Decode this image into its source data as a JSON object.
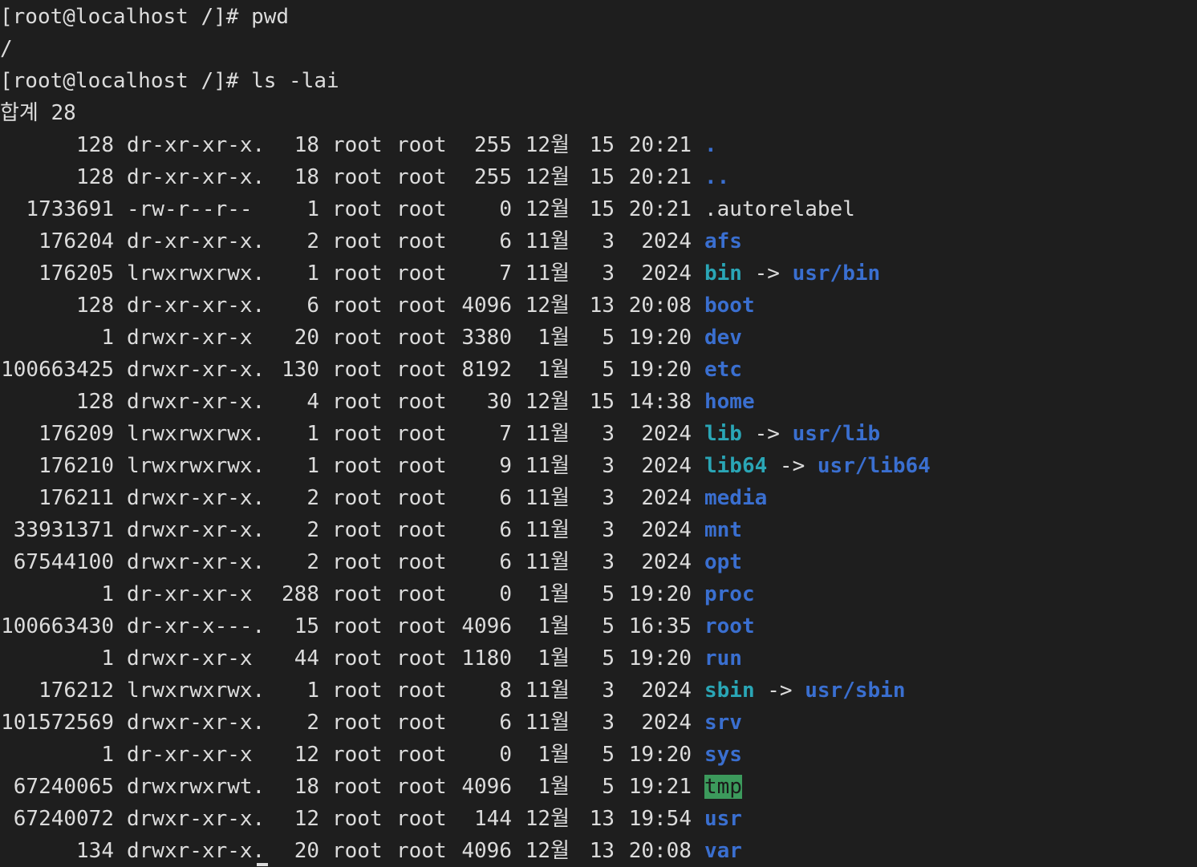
{
  "terminal": {
    "lines": [
      "[root@localhost /]# pwd",
      "/",
      "[root@localhost /]# ls -lai",
      "합계 28"
    ],
    "entries": [
      {
        "inode": "128",
        "perms": "dr-xr-xr-x.",
        "links": "18",
        "owner": "root",
        "group": "root",
        "size": "255",
        "month": "12월",
        "day": "15",
        "time": "20:21",
        "name": ".",
        "type": "dir",
        "target": ""
      },
      {
        "inode": "128",
        "perms": "dr-xr-xr-x.",
        "links": "18",
        "owner": "root",
        "group": "root",
        "size": "255",
        "month": "12월",
        "day": "15",
        "time": "20:21",
        "name": "..",
        "type": "dir",
        "target": ""
      },
      {
        "inode": "1733691",
        "perms": "-rw-r--r--",
        "links": "1",
        "owner": "root",
        "group": "root",
        "size": "0",
        "month": "12월",
        "day": "15",
        "time": "20:21",
        "name": ".autorelabel",
        "type": "file",
        "target": ""
      },
      {
        "inode": "176204",
        "perms": "dr-xr-xr-x.",
        "links": "2",
        "owner": "root",
        "group": "root",
        "size": "6",
        "month": "11월",
        "day": "3",
        "time": "2024",
        "name": "afs",
        "type": "dir",
        "target": ""
      },
      {
        "inode": "176205",
        "perms": "lrwxrwxrwx.",
        "links": "1",
        "owner": "root",
        "group": "root",
        "size": "7",
        "month": "11월",
        "day": "3",
        "time": "2024",
        "name": "bin",
        "type": "link",
        "target": "usr/bin"
      },
      {
        "inode": "128",
        "perms": "dr-xr-xr-x.",
        "links": "6",
        "owner": "root",
        "group": "root",
        "size": "4096",
        "month": "12월",
        "day": "13",
        "time": "20:08",
        "name": "boot",
        "type": "dir",
        "target": ""
      },
      {
        "inode": "1",
        "perms": "drwxr-xr-x",
        "links": "20",
        "owner": "root",
        "group": "root",
        "size": "3380",
        "month": "1월",
        "day": "5",
        "time": "19:20",
        "name": "dev",
        "type": "dir",
        "target": ""
      },
      {
        "inode": "100663425",
        "perms": "drwxr-xr-x.",
        "links": "130",
        "owner": "root",
        "group": "root",
        "size": "8192",
        "month": "1월",
        "day": "5",
        "time": "19:20",
        "name": "etc",
        "type": "dir",
        "target": ""
      },
      {
        "inode": "128",
        "perms": "drwxr-xr-x.",
        "links": "4",
        "owner": "root",
        "group": "root",
        "size": "30",
        "month": "12월",
        "day": "15",
        "time": "14:38",
        "name": "home",
        "type": "dir",
        "target": ""
      },
      {
        "inode": "176209",
        "perms": "lrwxrwxrwx.",
        "links": "1",
        "owner": "root",
        "group": "root",
        "size": "7",
        "month": "11월",
        "day": "3",
        "time": "2024",
        "name": "lib",
        "type": "link",
        "target": "usr/lib"
      },
      {
        "inode": "176210",
        "perms": "lrwxrwxrwx.",
        "links": "1",
        "owner": "root",
        "group": "root",
        "size": "9",
        "month": "11월",
        "day": "3",
        "time": "2024",
        "name": "lib64",
        "type": "link",
        "target": "usr/lib64"
      },
      {
        "inode": "176211",
        "perms": "drwxr-xr-x.",
        "links": "2",
        "owner": "root",
        "group": "root",
        "size": "6",
        "month": "11월",
        "day": "3",
        "time": "2024",
        "name": "media",
        "type": "dir",
        "target": ""
      },
      {
        "inode": "33931371",
        "perms": "drwxr-xr-x.",
        "links": "2",
        "owner": "root",
        "group": "root",
        "size": "6",
        "month": "11월",
        "day": "3",
        "time": "2024",
        "name": "mnt",
        "type": "dir",
        "target": ""
      },
      {
        "inode": "67544100",
        "perms": "drwxr-xr-x.",
        "links": "2",
        "owner": "root",
        "group": "root",
        "size": "6",
        "month": "11월",
        "day": "3",
        "time": "2024",
        "name": "opt",
        "type": "dir",
        "target": ""
      },
      {
        "inode": "1",
        "perms": "dr-xr-xr-x",
        "links": "288",
        "owner": "root",
        "group": "root",
        "size": "0",
        "month": "1월",
        "day": "5",
        "time": "19:20",
        "name": "proc",
        "type": "dir",
        "target": ""
      },
      {
        "inode": "100663430",
        "perms": "dr-xr-x---.",
        "links": "15",
        "owner": "root",
        "group": "root",
        "size": "4096",
        "month": "1월",
        "day": "5",
        "time": "16:35",
        "name": "root",
        "type": "dir",
        "target": ""
      },
      {
        "inode": "1",
        "perms": "drwxr-xr-x",
        "links": "44",
        "owner": "root",
        "group": "root",
        "size": "1180",
        "month": "1월",
        "day": "5",
        "time": "19:20",
        "name": "run",
        "type": "dir",
        "target": ""
      },
      {
        "inode": "176212",
        "perms": "lrwxrwxrwx.",
        "links": "1",
        "owner": "root",
        "group": "root",
        "size": "8",
        "month": "11월",
        "day": "3",
        "time": "2024",
        "name": "sbin",
        "type": "link",
        "target": "usr/sbin"
      },
      {
        "inode": "101572569",
        "perms": "drwxr-xr-x.",
        "links": "2",
        "owner": "root",
        "group": "root",
        "size": "6",
        "month": "11월",
        "day": "3",
        "time": "2024",
        "name": "srv",
        "type": "dir",
        "target": ""
      },
      {
        "inode": "1",
        "perms": "dr-xr-xr-x",
        "links": "12",
        "owner": "root",
        "group": "root",
        "size": "0",
        "month": "1월",
        "day": "5",
        "time": "19:20",
        "name": "sys",
        "type": "dir",
        "target": ""
      },
      {
        "inode": "67240065",
        "perms": "drwxrwxrwt.",
        "links": "18",
        "owner": "root",
        "group": "root",
        "size": "4096",
        "month": "1월",
        "day": "5",
        "time": "19:21",
        "name": "tmp",
        "type": "sticky",
        "target": ""
      },
      {
        "inode": "67240072",
        "perms": "drwxr-xr-x.",
        "links": "12",
        "owner": "root",
        "group": "root",
        "size": "144",
        "month": "12월",
        "day": "13",
        "time": "19:54",
        "name": "usr",
        "type": "dir",
        "target": ""
      },
      {
        "inode": "134",
        "perms": "drwxr-xr-x.",
        "links": "20",
        "owner": "root",
        "group": "root",
        "size": "4096",
        "month": "12월",
        "day": "13",
        "time": "20:08",
        "name": "var",
        "type": "dir",
        "target": ""
      }
    ],
    "arrow": "->",
    "colors": {
      "background": "#1e1e1e",
      "text": "#dcdcdc",
      "directory": "#3a6fd0",
      "symlink": "#2aa6b6",
      "sticky_bg": "#3c9a5c"
    }
  }
}
